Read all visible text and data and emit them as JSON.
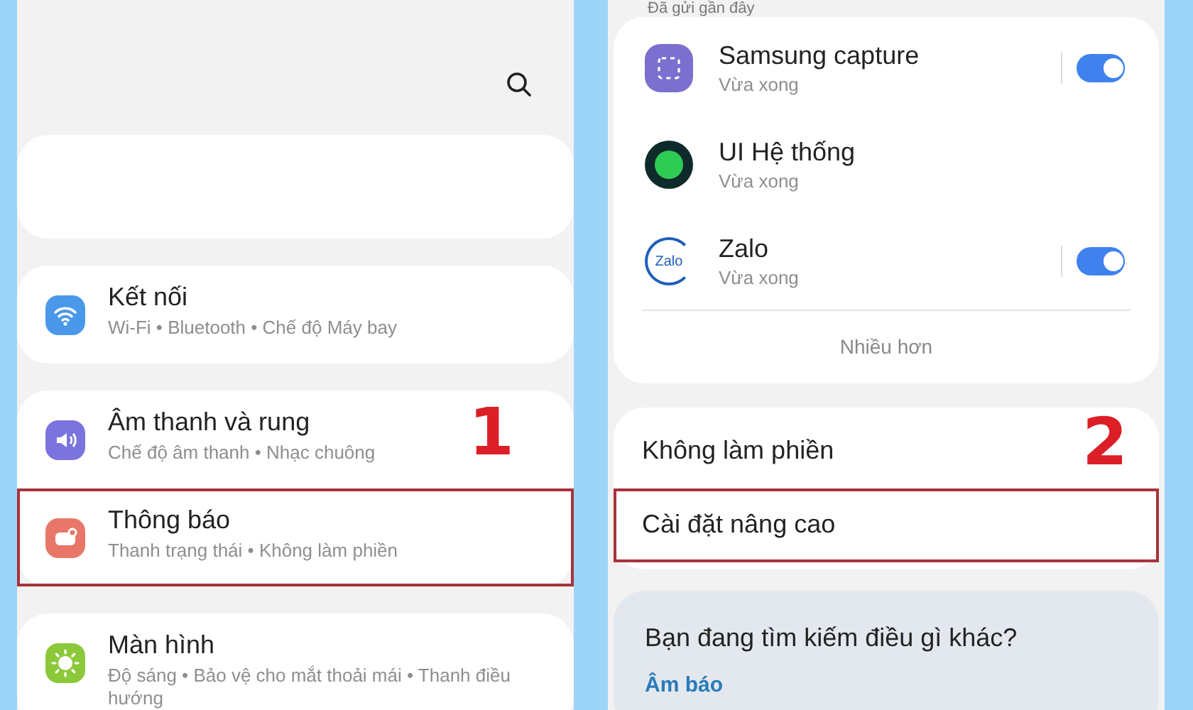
{
  "settings_screen": {
    "groups": [
      [
        {
          "title": "Kết nối",
          "subtitle": "Wi-Fi • Bluetooth • Chế độ Máy bay",
          "kind": "wifi",
          "highlighted": false
        }
      ],
      [
        {
          "title": "Âm thanh và rung",
          "subtitle": "Chế độ âm thanh • Nhạc chuông",
          "kind": "sound",
          "highlighted": false,
          "annotation": "1"
        },
        {
          "title": "Thông báo",
          "subtitle": "Thanh trạng thái • Không làm phiền",
          "kind": "notification",
          "highlighted": true
        }
      ],
      [
        {
          "title": "Màn hình",
          "subtitle": "Độ sáng • Bảo vệ cho mắt thoải mái • Thanh điều hướng",
          "kind": "display",
          "highlighted": false
        }
      ]
    ]
  },
  "notifications_screen": {
    "section_label": "Đã gửi gần đây",
    "recent_apps": [
      {
        "name": "Samsung capture",
        "time": "Vừa xong",
        "kind": "toggle",
        "on": true
      },
      {
        "name": "UI Hệ thống",
        "time": "Vừa xong",
        "kind": "plain"
      },
      {
        "name": "Zalo",
        "time": "Vừa xong",
        "icon_text": "Zalo",
        "kind": "toggle",
        "on": true
      }
    ],
    "more": "Nhiều hơn",
    "items": [
      {
        "label": "Không làm phiền",
        "highlighted": false,
        "annotation": "2"
      },
      {
        "label": "Cài đặt nâng cao",
        "highlighted": true
      }
    ],
    "suggestion": {
      "title": "Bạn đang tìm kiếm điều gì khác?",
      "link": "Âm báo"
    }
  }
}
